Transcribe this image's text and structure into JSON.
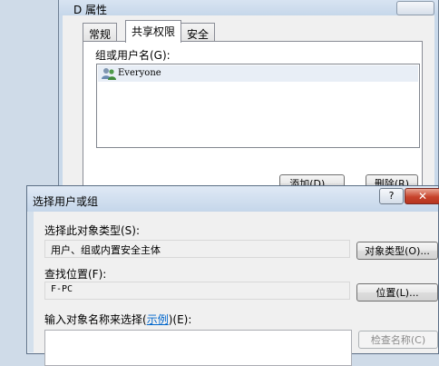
{
  "props": {
    "title": "D 属性",
    "tabs": [
      "常规",
      "共享权限",
      "安全"
    ],
    "group_label": "组或用户名(G):",
    "users": [
      "Everyone"
    ],
    "add_button": "添加(D)...",
    "remove_button": "删除(R)"
  },
  "select": {
    "title": "选择用户或组",
    "help": "?",
    "close": "✕",
    "object_type_label": "选择此对象类型(S):",
    "object_type_value": "用户、组或内置安全主体",
    "object_type_button": "对象类型(O)...",
    "location_label": "查找位置(F):",
    "location_value": "F-PC",
    "location_button": "位置(L)...",
    "names_label_prefix": "输入对象名称来选择(",
    "names_label_link": "示例",
    "names_label_suffix": ")(E):",
    "check_names_button": "检查名称(C)"
  }
}
